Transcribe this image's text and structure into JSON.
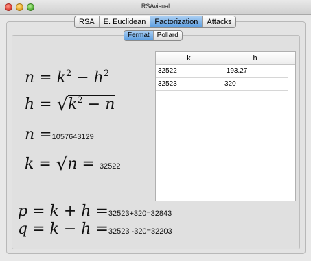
{
  "window": {
    "title": "RSAvisual"
  },
  "main_tabs": [
    {
      "label": "RSA",
      "active": false
    },
    {
      "label": "E. Euclidean",
      "active": false
    },
    {
      "label": "Factorization",
      "active": true
    },
    {
      "label": "Attacks",
      "active": false
    }
  ],
  "sub_tabs": [
    {
      "label": "Fermat",
      "active": true
    },
    {
      "label": "Pollard",
      "active": false
    }
  ],
  "table": {
    "columns": [
      "k",
      "h"
    ],
    "rows": [
      [
        "32522",
        " 193.27"
      ],
      [
        "32523",
        "320"
      ]
    ]
  },
  "formulas": {
    "n_value": "1057643129",
    "k_value": "32522",
    "p_value": "32523+320=32843",
    "q_value": "32523 -320=32203"
  },
  "colors": {
    "active_tab": "#5c9ee0",
    "panel_bg": "#e0e0e0"
  }
}
